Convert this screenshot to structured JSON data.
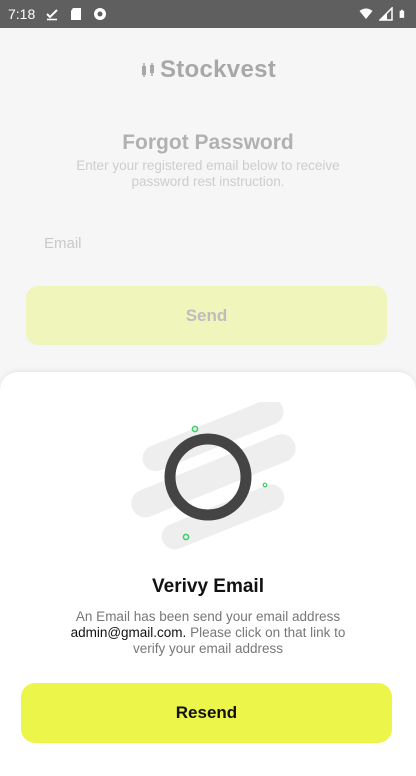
{
  "status_bar": {
    "time": "7:18",
    "icons_left": [
      "check-download-icon",
      "sd-card-icon",
      "chrome-icon"
    ],
    "icons_right": [
      "wifi-icon",
      "signal-icon",
      "battery-icon"
    ]
  },
  "brand": {
    "name": "Stockvest",
    "accent_color": "#ebf54a"
  },
  "forgot": {
    "title": "Forgot Password",
    "subtitle": "Enter your registered email below to receive password rest instruction.",
    "email_placeholder": "Email",
    "send_label": "Send"
  },
  "sheet": {
    "title": "Verivy Email",
    "message_prefix": "An Email has been send your email address",
    "email": "admin@gmail.com.",
    "message_suffix": "Please click on that link to verify your email address",
    "resend_label": "Resend"
  }
}
